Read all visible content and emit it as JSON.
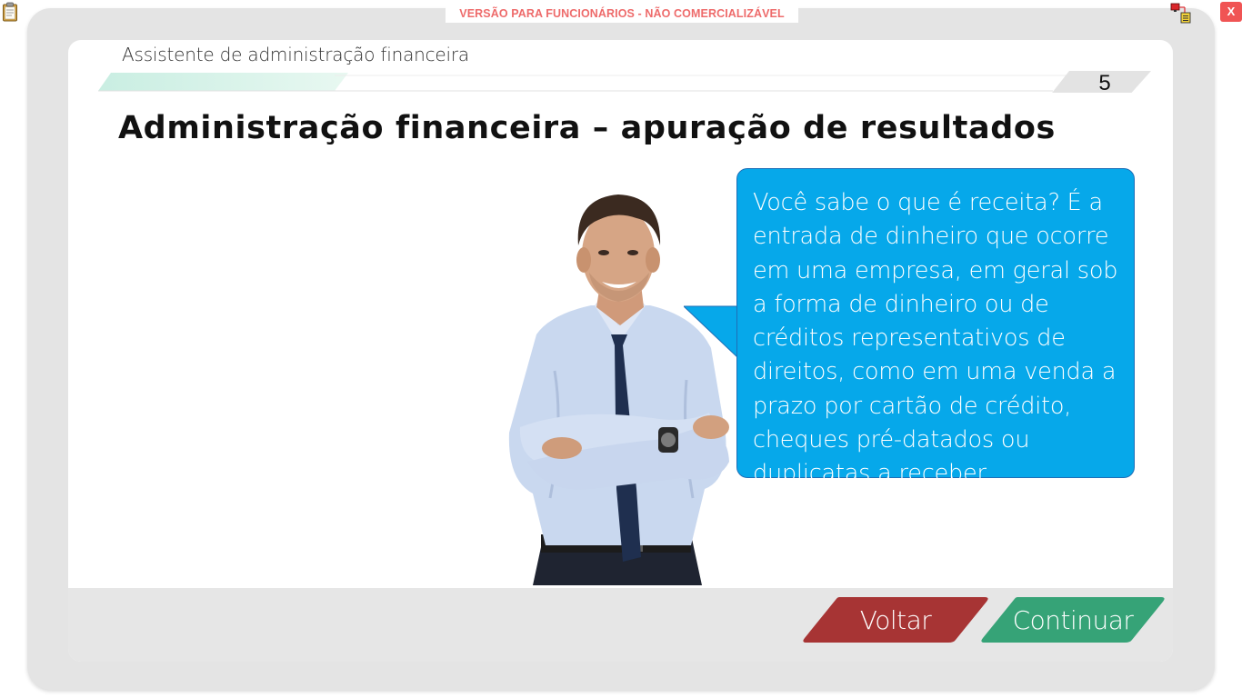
{
  "banner": {
    "watermark": "VERSÃO PARA FUNCIONÁRIOS - NÃO COMERCIALIZÁVEL",
    "close_label": "X",
    "icons": [
      "clipboard-icon",
      "network-status-icon"
    ]
  },
  "header": {
    "course_title": "Assistente de administração financeira",
    "page_number": "5"
  },
  "slide": {
    "title": "Administração financeira – apuração de resultados",
    "speech_text": "Você sabe o que é receita? É a entrada de dinheiro que ocorre em uma empresa, em geral sob a forma de dinheiro ou de créditos representativos de direitos, como em uma venda a prazo por cartão de crédito, cheques pré-datados ou duplicatas a receber."
  },
  "footer": {
    "back_label": "Voltar",
    "next_label": "Continuar"
  },
  "colors": {
    "bubble": "#06a8ea",
    "back_button": "#a73434",
    "next_button": "#36a377",
    "watermark": "#ee6b6b",
    "frame": "#e4e4e4"
  }
}
